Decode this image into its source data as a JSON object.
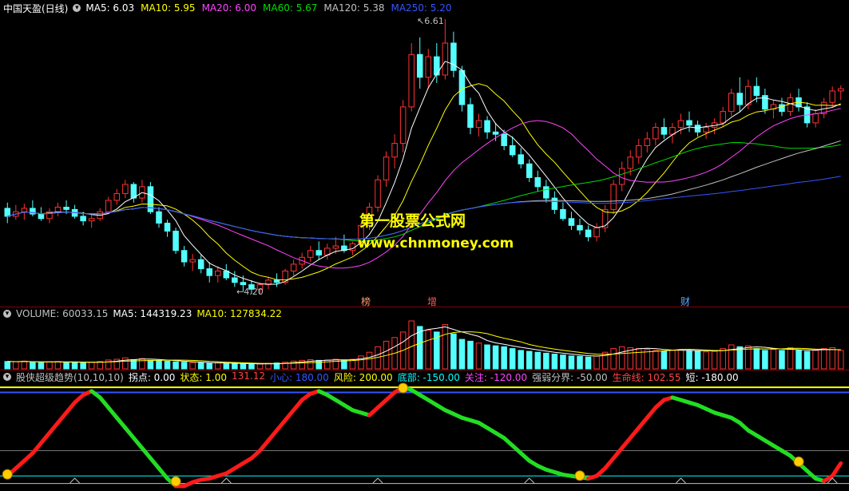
{
  "main": {
    "title": "中国天盈(日线)",
    "ma_items": [
      {
        "label": "MA5: 6.03",
        "color": "#ffffff"
      },
      {
        "label": "MA10: 5.95",
        "color": "#ffff00"
      },
      {
        "label": "MA20: 6.00",
        "color": "#ff44ff"
      },
      {
        "label": "MA60: 5.67",
        "color": "#00dd00"
      },
      {
        "label": "MA120: 5.38",
        "color": "#c0c0c0"
      },
      {
        "label": "MA250: 5.20",
        "color": "#3355ff"
      }
    ],
    "high_label": "6.61",
    "low_label": "4.20",
    "watermark_cn": "第一股票公式网",
    "watermark_url": "www.chnmoney.com",
    "event_tags": [
      {
        "text": "榜",
        "color": "#ff9966"
      },
      {
        "text": "增",
        "color": "#ff5555"
      },
      {
        "text": "财",
        "color": "#55aaff"
      }
    ]
  },
  "volume": {
    "label": "VOLUME: 60033.15",
    "ma5": "MA5: 144319.23",
    "ma10": "MA10: 127834.22"
  },
  "indicator": {
    "name": "股侠超级趋势(10,10,10)",
    "items": [
      {
        "label": "拐点: 0.00",
        "color": "#ffffff"
      },
      {
        "label": "状态: 1.00",
        "color": "#ffff00"
      },
      {
        "label": "131.12",
        "color": "#ff4444"
      },
      {
        "label": "小心: 180.00",
        "color": "#3355ff"
      },
      {
        "label": "风险: 200.00",
        "color": "#ffff00"
      },
      {
        "label": "底部: -150.00",
        "color": "#00ffff"
      },
      {
        "label": "关注: -120.00",
        "color": "#ff44ff"
      },
      {
        "label": "强弱分界: -50.00",
        "color": "#c0c0c0"
      },
      {
        "label": "生命线: 102.55",
        "color": "#ff4444"
      },
      {
        "label": "短: -180.00",
        "color": "#ffffff"
      }
    ]
  },
  "chart_data": [
    {
      "type": "candlestick",
      "title": "中国天盈(日线)",
      "price_range": [
        4.2,
        6.61
      ],
      "ohlc": [
        [
          4.95,
          5.0,
          4.82,
          4.88
        ],
        [
          4.88,
          4.98,
          4.85,
          4.92
        ],
        [
          4.92,
          4.99,
          4.85,
          4.95
        ],
        [
          4.95,
          5.02,
          4.88,
          4.9
        ],
        [
          4.9,
          4.96,
          4.84,
          4.86
        ],
        [
          4.86,
          4.95,
          4.82,
          4.92
        ],
        [
          4.92,
          5.0,
          4.88,
          4.96
        ],
        [
          4.96,
          5.02,
          4.9,
          4.94
        ],
        [
          4.94,
          4.98,
          4.86,
          4.88
        ],
        [
          4.88,
          4.92,
          4.8,
          4.84
        ],
        [
          4.84,
          4.9,
          4.78,
          4.86
        ],
        [
          4.86,
          4.95,
          4.84,
          4.92
        ],
        [
          4.92,
          5.05,
          4.9,
          5.02
        ],
        [
          5.02,
          5.12,
          4.98,
          5.08
        ],
        [
          5.08,
          5.2,
          5.04,
          5.16
        ],
        [
          5.16,
          5.18,
          5.0,
          5.04
        ],
        [
          5.04,
          5.2,
          5.0,
          5.14
        ],
        [
          5.14,
          5.18,
          4.9,
          4.92
        ],
        [
          4.92,
          4.96,
          4.78,
          4.82
        ],
        [
          4.82,
          4.85,
          4.7,
          4.75
        ],
        [
          4.75,
          4.78,
          4.55,
          4.58
        ],
        [
          4.58,
          4.62,
          4.44,
          4.48
        ],
        [
          4.48,
          4.55,
          4.4,
          4.5
        ],
        [
          4.5,
          4.54,
          4.38,
          4.42
        ],
        [
          4.42,
          4.48,
          4.3,
          4.36
        ],
        [
          4.36,
          4.44,
          4.3,
          4.4
        ],
        [
          4.4,
          4.46,
          4.32,
          4.34
        ],
        [
          4.34,
          4.4,
          4.26,
          4.3
        ],
        [
          4.3,
          4.36,
          4.22,
          4.28
        ],
        [
          4.28,
          4.32,
          4.2,
          4.24
        ],
        [
          4.24,
          4.3,
          4.2,
          4.28
        ],
        [
          4.28,
          4.35,
          4.24,
          4.32
        ],
        [
          4.32,
          4.38,
          4.26,
          4.3
        ],
        [
          4.3,
          4.42,
          4.28,
          4.4
        ],
        [
          4.4,
          4.5,
          4.36,
          4.46
        ],
        [
          4.46,
          4.56,
          4.42,
          4.52
        ],
        [
          4.52,
          4.62,
          4.48,
          4.58
        ],
        [
          4.58,
          4.66,
          4.5,
          4.54
        ],
        [
          4.54,
          4.64,
          4.5,
          4.6
        ],
        [
          4.6,
          4.7,
          4.55,
          4.62
        ],
        [
          4.62,
          4.72,
          4.56,
          4.58
        ],
        [
          4.58,
          4.66,
          4.54,
          4.64
        ],
        [
          4.64,
          4.82,
          4.6,
          4.8
        ],
        [
          4.8,
          5.0,
          4.76,
          4.96
        ],
        [
          4.96,
          5.24,
          4.92,
          5.2
        ],
        [
          5.2,
          5.45,
          5.14,
          5.4
        ],
        [
          5.4,
          5.6,
          5.3,
          5.52
        ],
        [
          5.52,
          5.9,
          5.44,
          5.84
        ],
        [
          5.84,
          6.4,
          5.8,
          6.3
        ],
        [
          6.3,
          6.45,
          6.0,
          6.1
        ],
        [
          6.1,
          6.35,
          6.0,
          6.28
        ],
        [
          6.28,
          6.4,
          6.05,
          6.12
        ],
        [
          6.12,
          6.61,
          6.08,
          6.4
        ],
        [
          6.4,
          6.5,
          6.1,
          6.16
        ],
        [
          6.16,
          6.2,
          5.8,
          5.86
        ],
        [
          5.86,
          5.92,
          5.6,
          5.66
        ],
        [
          5.66,
          5.78,
          5.58,
          5.72
        ],
        [
          5.72,
          5.76,
          5.56,
          5.62
        ],
        [
          5.62,
          5.7,
          5.54,
          5.6
        ],
        [
          5.6,
          5.64,
          5.46,
          5.5
        ],
        [
          5.5,
          5.58,
          5.4,
          5.42
        ],
        [
          5.42,
          5.48,
          5.3,
          5.34
        ],
        [
          5.34,
          5.38,
          5.18,
          5.22
        ],
        [
          5.22,
          5.28,
          5.1,
          5.14
        ],
        [
          5.14,
          5.2,
          5.0,
          5.04
        ],
        [
          5.04,
          5.1,
          4.9,
          4.94
        ],
        [
          4.94,
          5.0,
          4.84,
          4.86
        ],
        [
          4.86,
          4.92,
          4.76,
          4.8
        ],
        [
          4.8,
          4.86,
          4.72,
          4.76
        ],
        [
          4.76,
          4.8,
          4.66,
          4.7
        ],
        [
          4.7,
          4.82,
          4.66,
          4.78
        ],
        [
          4.78,
          4.98,
          4.74,
          4.94
        ],
        [
          4.94,
          5.2,
          4.9,
          5.16
        ],
        [
          5.16,
          5.36,
          5.1,
          5.3
        ],
        [
          5.3,
          5.46,
          5.24,
          5.4
        ],
        [
          5.4,
          5.56,
          5.34,
          5.5
        ],
        [
          5.5,
          5.62,
          5.44,
          5.56
        ],
        [
          5.56,
          5.7,
          5.5,
          5.66
        ],
        [
          5.66,
          5.74,
          5.56,
          5.6
        ],
        [
          5.6,
          5.7,
          5.52,
          5.66
        ],
        [
          5.66,
          5.78,
          5.6,
          5.72
        ],
        [
          5.72,
          5.8,
          5.62,
          5.68
        ],
        [
          5.68,
          5.72,
          5.58,
          5.62
        ],
        [
          5.62,
          5.7,
          5.56,
          5.66
        ],
        [
          5.66,
          5.74,
          5.6,
          5.7
        ],
        [
          5.7,
          5.84,
          5.66,
          5.8
        ],
        [
          5.8,
          6.0,
          5.76,
          5.96
        ],
        [
          5.96,
          6.1,
          5.8,
          5.86
        ],
        [
          5.86,
          6.08,
          5.82,
          6.02
        ],
        [
          6.02,
          6.1,
          5.88,
          5.94
        ],
        [
          5.94,
          6.0,
          5.78,
          5.82
        ],
        [
          5.82,
          5.9,
          5.74,
          5.86
        ],
        [
          5.86,
          5.92,
          5.76,
          5.8
        ],
        [
          5.8,
          5.96,
          5.76,
          5.92
        ],
        [
          5.92,
          6.0,
          5.8,
          5.84
        ],
        [
          5.84,
          5.88,
          5.66,
          5.7
        ],
        [
          5.7,
          5.82,
          5.66,
          5.78
        ],
        [
          5.78,
          5.92,
          5.74,
          5.88
        ],
        [
          5.88,
          6.02,
          5.84,
          5.98
        ],
        [
          5.98,
          6.03,
          5.9,
          6.0
        ]
      ],
      "moving_averages": [
        {
          "name": "MA5",
          "color": "#ffffff",
          "value": 6.03
        },
        {
          "name": "MA10",
          "color": "#ffff00",
          "value": 5.95
        },
        {
          "name": "MA20",
          "color": "#ff44ff",
          "value": 6.0
        },
        {
          "name": "MA60",
          "color": "#00dd00",
          "value": 5.67
        },
        {
          "name": "MA120",
          "color": "#c0c0c0",
          "value": 5.38
        },
        {
          "name": "MA250",
          "color": "#3355ff",
          "value": 5.2
        }
      ]
    },
    {
      "type": "bar",
      "title": "VOLUME",
      "values": [
        40,
        38,
        42,
        36,
        34,
        38,
        40,
        36,
        34,
        32,
        36,
        40,
        48,
        52,
        60,
        50,
        56,
        46,
        44,
        42,
        38,
        36,
        34,
        32,
        30,
        32,
        30,
        28,
        26,
        24,
        26,
        30,
        32,
        36,
        42,
        46,
        50,
        46,
        48,
        52,
        48,
        52,
        70,
        90,
        120,
        150,
        170,
        200,
        260,
        230,
        210,
        200,
        240,
        190,
        160,
        150,
        140,
        130,
        125,
        120,
        110,
        100,
        95,
        90,
        85,
        80,
        75,
        70,
        68,
        64,
        70,
        90,
        110,
        120,
        115,
        110,
        105,
        100,
        95,
        100,
        105,
        100,
        95,
        92,
        95,
        110,
        130,
        120,
        125,
        110,
        100,
        105,
        100,
        115,
        100,
        95,
        100,
        110,
        115,
        100
      ],
      "ma5": 144319.23,
      "ma10": 127834.22
    },
    {
      "type": "line",
      "title": "股侠超级趋势(10,10,10)",
      "levels": {
        "风险": 200,
        "小心": 180,
        "生命线": 102.55,
        "强弱分界": -50,
        "关注": -120,
        "底部": -150,
        "短": -180
      },
      "y_range": [
        -200,
        210
      ],
      "values": [
        -150,
        -120,
        -90,
        -60,
        -20,
        20,
        60,
        100,
        140,
        170,
        185,
        160,
        120,
        80,
        40,
        0,
        -40,
        -80,
        -120,
        -160,
        -190,
        -190,
        -175,
        -165,
        -160,
        -150,
        -140,
        -120,
        -100,
        -80,
        -50,
        -10,
        30,
        70,
        110,
        150,
        175,
        185,
        170,
        150,
        130,
        110,
        100,
        90,
        120,
        150,
        180,
        200,
        190,
        170,
        150,
        130,
        110,
        95,
        80,
        70,
        60,
        40,
        20,
        0,
        -30,
        -60,
        -90,
        -110,
        -125,
        -135,
        -145,
        -150,
        -155,
        -160,
        -150,
        -120,
        -80,
        -40,
        0,
        40,
        80,
        120,
        150,
        160,
        150,
        140,
        130,
        115,
        100,
        90,
        80,
        60,
        30,
        10,
        -10,
        -30,
        -50,
        -70,
        -100,
        -130,
        -160,
        -170,
        -150,
        -100
      ]
    }
  ]
}
